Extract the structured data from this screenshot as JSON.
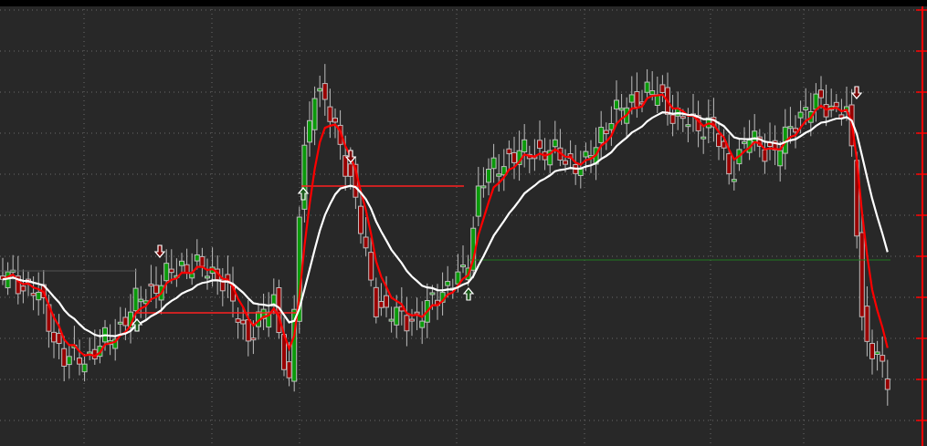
{
  "header": {
    "visible": true
  },
  "chart": {
    "indicators": [
      {
        "kind": "fast-average",
        "color": "#ff0000"
      },
      {
        "kind": "slow-average",
        "color": "#ffffff"
      }
    ]
  }
}
